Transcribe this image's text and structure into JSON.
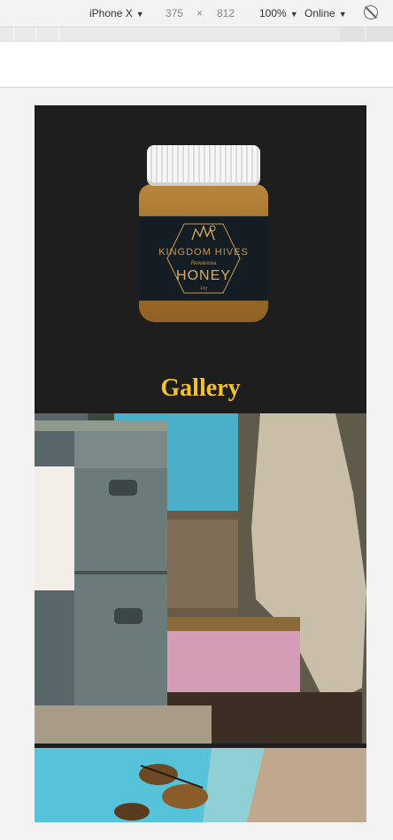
{
  "devtools": {
    "device": "iPhone X",
    "width": "375",
    "times": "×",
    "height": "812",
    "zoom": "100%",
    "network": "Online",
    "rotate_icon": "rotate-icon"
  },
  "product": {
    "brand": "KINGDOM HIVES",
    "variety": "Rewarewa",
    "name": "HONEY",
    "weight": "1kg"
  },
  "gallery": {
    "title": "Gallery"
  },
  "colors": {
    "accent": "#f2c233",
    "page_bg": "#1e1e1e"
  }
}
